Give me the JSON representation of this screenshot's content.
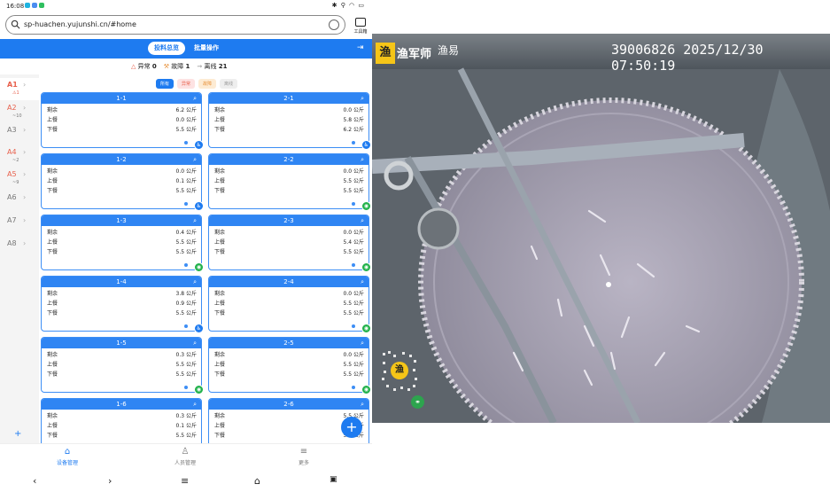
{
  "status": {
    "time": "16:08",
    "right_icons": "✱ ⚲ ◠ ▭"
  },
  "browser": {
    "url": "sp-huachen.yujunshi.cn/#home",
    "toolbox_label": "工具箱"
  },
  "tabs": [
    {
      "label": "投料总览"
    },
    {
      "label": "批量操作"
    }
  ],
  "summary": {
    "abnormal_label": "异常",
    "abnormal_count": "0",
    "fault_label": "故障",
    "fault_count": "1",
    "offline_label": "离线",
    "offline_count": "21"
  },
  "sidebar": [
    {
      "name": "A1",
      "sub": "⚠1"
    },
    {
      "name": "A2",
      "sub": "~10"
    },
    {
      "name": "A3",
      "sub": ""
    },
    {
      "name": "A4",
      "sub": "~2"
    },
    {
      "name": "A5",
      "sub": "~9"
    },
    {
      "name": "A6",
      "sub": ""
    },
    {
      "name": "A7",
      "sub": ""
    },
    {
      "name": "A8",
      "sub": ""
    }
  ],
  "filters": [
    {
      "label": "所有",
      "bg": "#1e7bf0",
      "fg": "#ffffff"
    },
    {
      "label": "异常",
      "bg": "#fde2e2",
      "fg": "#e8604c"
    },
    {
      "label": "故障",
      "bg": "#fdebd3",
      "fg": "#e8923c"
    },
    {
      "label": "离线",
      "bg": "#eeeeee",
      "fg": "#999999"
    }
  ],
  "row_labels": [
    "剩余",
    "上餐",
    "下餐"
  ],
  "cards": [
    {
      "id": "1-1",
      "vals": [
        "6.2 公斤",
        "0.0 公斤",
        "5.5 公斤"
      ],
      "badge": "blue"
    },
    {
      "id": "2-1",
      "vals": [
        "0.0 公斤",
        "5.8 公斤",
        "6.2 公斤"
      ],
      "badge": "blue"
    },
    {
      "id": "1-2",
      "vals": [
        "0.0 公斤",
        "0.1 公斤",
        "5.5 公斤"
      ],
      "badge": "blue"
    },
    {
      "id": "2-2",
      "vals": [
        "0.0 公斤",
        "5.5 公斤",
        "5.5 公斤"
      ],
      "badge": "green"
    },
    {
      "id": "1-3",
      "vals": [
        "0.4 公斤",
        "5.5 公斤",
        "5.5 公斤"
      ],
      "badge": "green"
    },
    {
      "id": "2-3",
      "vals": [
        "0.0 公斤",
        "5.4 公斤",
        "5.5 公斤"
      ],
      "badge": "green"
    },
    {
      "id": "1-4",
      "vals": [
        "3.8 公斤",
        "0.9 公斤",
        "5.5 公斤"
      ],
      "badge": "blue"
    },
    {
      "id": "2-4",
      "vals": [
        "0.0 公斤",
        "5.5 公斤",
        "5.5 公斤"
      ],
      "badge": "green"
    },
    {
      "id": "1-5",
      "vals": [
        "0.3 公斤",
        "5.5 公斤",
        "5.5 公斤"
      ],
      "badge": "green"
    },
    {
      "id": "2-5",
      "vals": [
        "0.0 公斤",
        "5.5 公斤",
        "5.5 公斤"
      ],
      "badge": "green"
    },
    {
      "id": "1-6",
      "vals": [
        "0.3 公斤",
        "0.1 公斤",
        "5.5 公斤"
      ],
      "badge": "blue"
    },
    {
      "id": "2-6",
      "vals": [
        "5.5 公斤",
        "5.5 公斤",
        "5.5 公斤"
      ],
      "badge": "none"
    }
  ],
  "bottom_nav": [
    {
      "label": "设备管理",
      "icon": "⌂"
    },
    {
      "label": "人员管理",
      "icon": "♙"
    },
    {
      "label": "更多",
      "icon": "≡"
    }
  ],
  "video": {
    "logo_text": "渔军师",
    "logo2": "渔易",
    "timestamp": "39006826 2025/12/30 07:50:19",
    "qr_char": "渔"
  },
  "colors": {
    "accent": "#1e7bf0",
    "badge_blue": "#1e7bf0",
    "badge_green": "#22b24c"
  }
}
